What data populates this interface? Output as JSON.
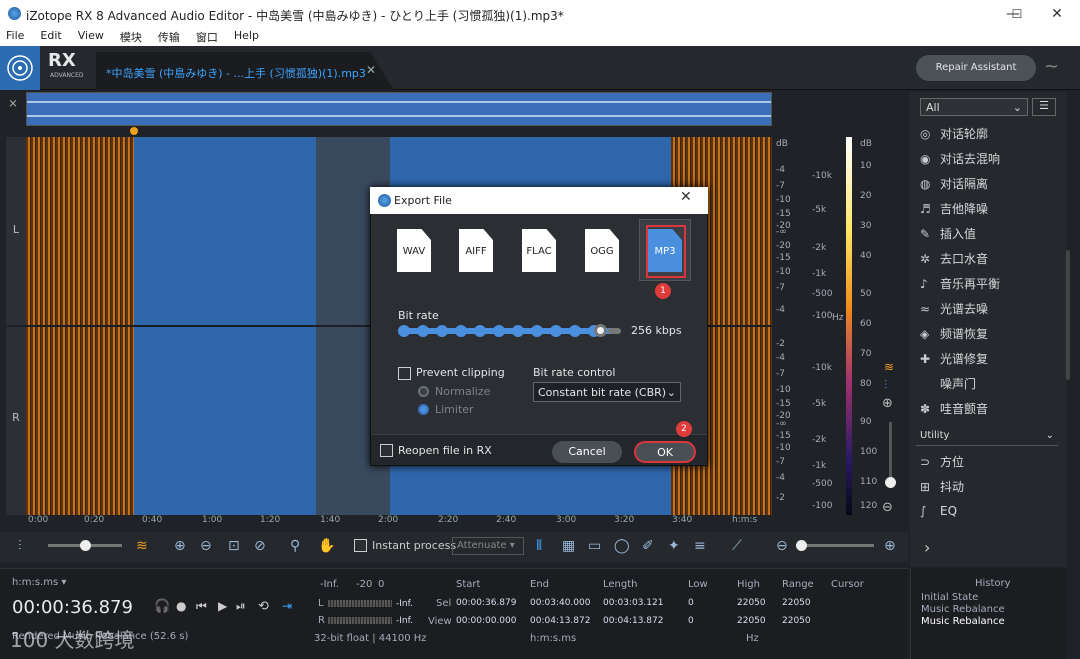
{
  "window": {
    "title": "iZotope RX 8 Advanced Audio Editor - 中岛美雪 (中島みゆき) - ひとり上手 (习惯孤独)(1).mp3*",
    "controls": [
      "—",
      "☐",
      "✕"
    ]
  },
  "menu": [
    "File",
    "Edit",
    "View",
    "模块",
    "传输",
    "窗口",
    "Help"
  ],
  "header": {
    "logo_text": "RX",
    "logo_sub": "ADVANCED",
    "file_tab": "*中岛美雪 (中島みゆき) - ...上手 (习惯孤独)(1).mp3",
    "file_tab_close": "✕",
    "repair_assistant": "Repair Assistant"
  },
  "channels": {
    "left": "L",
    "right": "R"
  },
  "db_scale_L": [
    "dB",
    "-4",
    "-7",
    "-10",
    "-15",
    "-20",
    "-∞",
    "-20",
    "-15",
    "-10",
    "-7",
    "-4"
  ],
  "db_scale_R": [
    "-2",
    "-4",
    "-7",
    "-10",
    "-15",
    "-20",
    "-∞",
    "-15",
    "-10",
    "-7",
    "-4",
    "-2"
  ],
  "hz_scale": [
    "Hz",
    "-10k",
    "-5k",
    "-2k",
    "-1k",
    "-500",
    "-100"
  ],
  "hz_scale2": [
    "-10k",
    "-5k",
    "-2k",
    "-1k",
    "-500",
    "-100"
  ],
  "colorbar_scale": [
    "dB",
    "10",
    "20",
    "30",
    "40",
    "50",
    "60",
    "70",
    "80",
    "90",
    "100",
    "110",
    "120"
  ],
  "timeline": [
    "0:00",
    "0:20",
    "0:40",
    "1:00",
    "1:20",
    "1:40",
    "2:00",
    "2:20",
    "2:40",
    "3:00",
    "3:20",
    "3:40",
    "h:m:s"
  ],
  "toolbar": {
    "instant_process": "Instant process",
    "attenuate": "Attenuate"
  },
  "modules": {
    "filter": "All",
    "items": [
      {
        "icon": "◎",
        "label": "对话轮廓"
      },
      {
        "icon": "◉",
        "label": "对话去混响"
      },
      {
        "icon": "◍",
        "label": "对话隔离"
      },
      {
        "icon": "♬",
        "label": "吉他降噪"
      },
      {
        "icon": "✎",
        "label": "插入值"
      },
      {
        "icon": "✲",
        "label": "去口水音"
      },
      {
        "icon": "♪",
        "label": "音乐再平衡"
      },
      {
        "icon": "≈",
        "label": "光谱去噪"
      },
      {
        "icon": "◈",
        "label": "频谱恢复"
      },
      {
        "icon": "✚",
        "label": "光谱修复"
      },
      {
        "icon": "",
        "label": "噪声门"
      },
      {
        "icon": "✽",
        "label": "哇音颤音"
      }
    ],
    "utility_header": "Utility",
    "utility": [
      {
        "icon": "⊃",
        "label": "方位"
      },
      {
        "icon": "⊞",
        "label": "抖动"
      },
      {
        "icon": "∫",
        "label": "EQ"
      }
    ],
    "expand": "›"
  },
  "bottom": {
    "time_format": "h:m:s.ms ▾",
    "current_time": "00:00:36.879",
    "status": "Rendered Music Rebalance (52.6 s)",
    "meter_labels": [
      "-Inf.",
      "-20",
      "0"
    ],
    "meter_L": "-Inf.",
    "meter_R": "-Inf.",
    "format": "32-bit float | 44100 Hz",
    "headers": [
      "Start",
      "End",
      "Length",
      "Low",
      "High",
      "Range",
      "Cursor"
    ],
    "sel_label": "Sel",
    "view_label": "View",
    "sel": [
      "00:00:36.879",
      "00:03:40.000",
      "00:03:03.121",
      "0",
      "22050",
      "22050"
    ],
    "view": [
      "00:00:00.000",
      "00:04:13.872",
      "00:04:13.872",
      "0",
      "22050",
      "22050"
    ],
    "time_unit": "h:m:s.ms",
    "freq_unit": "Hz"
  },
  "history": {
    "title": "History",
    "items": [
      "Initial State",
      "Music Rebalance",
      "Music Rebalance"
    ]
  },
  "dialog": {
    "title": "Export File",
    "close": "✕",
    "formats": [
      "WAV",
      "AIFF",
      "FLAC",
      "OGG",
      "MP3"
    ],
    "bitrate_label": "Bit rate",
    "bitrate_value": "256 kbps",
    "bitrate_fraction": 0.92,
    "prevent_clipping": "Prevent clipping",
    "normalize": "Normalize",
    "limiter": "Limiter",
    "bitrate_control_label": "Bit rate control",
    "bitrate_control_value": "Constant bit rate (CBR)",
    "reopen": "Reopen file in RX",
    "cancel": "Cancel",
    "ok": "OK",
    "step1": "1",
    "step2": "2"
  },
  "watermark": "100 大数跨境"
}
